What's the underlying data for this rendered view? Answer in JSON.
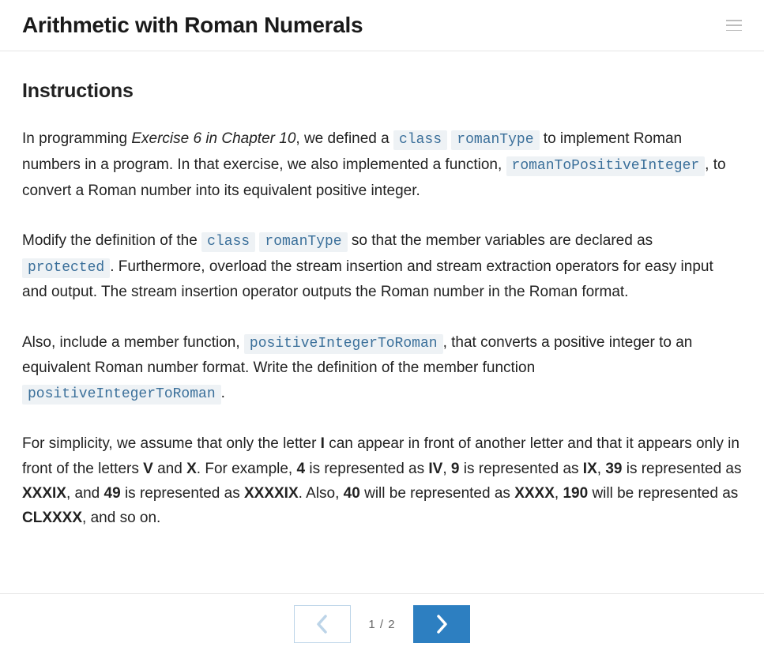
{
  "header": {
    "title": "Arithmetic with Roman Numerals"
  },
  "section": {
    "heading": "Instructions"
  },
  "p1": {
    "t1": "In programming ",
    "em": "Exercise 6 in Chapter 10",
    "t2": ", we defined a ",
    "c1": "class",
    "sp1": " ",
    "c2": "romanType",
    "t3": " to implement Roman numbers in a program. In that exercise, we also implemented a function, ",
    "c3": "romanToPositiveInteger",
    "t4": ", to convert a Roman number into its equivalent positive integer."
  },
  "p2": {
    "t1": "Modify the definition of the ",
    "c1": "class",
    "sp1": " ",
    "c2": "romanType",
    "t2": " so that the member variables are declared as ",
    "c3": "protected",
    "t3": ". Furthermore, overload the stream insertion and stream extraction operators for easy input and output. The stream insertion operator outputs the Roman number in the Roman format."
  },
  "p3": {
    "t1": "Also, include a member function, ",
    "c1": "positiveIntegerToRoman",
    "t2": ", that converts a positive integer to an equivalent Roman number format. Write the definition of the member function ",
    "c2": "positiveIntegerToRoman",
    "t3": "."
  },
  "p4": {
    "t1": "For simplicity, we assume that only the letter ",
    "b1": "I",
    "t2": " can appear in front of another letter and that it appears only in front of the letters ",
    "b2": "V",
    "t3": " and ",
    "b3": "X",
    "t4": ". For example, ",
    "b4": "4",
    "t5": " is represented as ",
    "b5": "IV",
    "t6": ", ",
    "b6": "9",
    "t7": " is represented as ",
    "b7": "IX",
    "t8": ", ",
    "b8": "39",
    "t9": " is represented as ",
    "b9": "XXXIX",
    "t10": ", and ",
    "b10": "49",
    "t11": " is represented as ",
    "b11": "XXXXIX",
    "t12": ". Also, ",
    "b12": "40",
    "t13": " will be represented as ",
    "b13": "XXXX",
    "t14": ", ",
    "b14": "190",
    "t15": " will be represented as ",
    "b15": "CLXXXX",
    "t16": ", and so on."
  },
  "pagination": {
    "indicator": "1 / 2"
  }
}
